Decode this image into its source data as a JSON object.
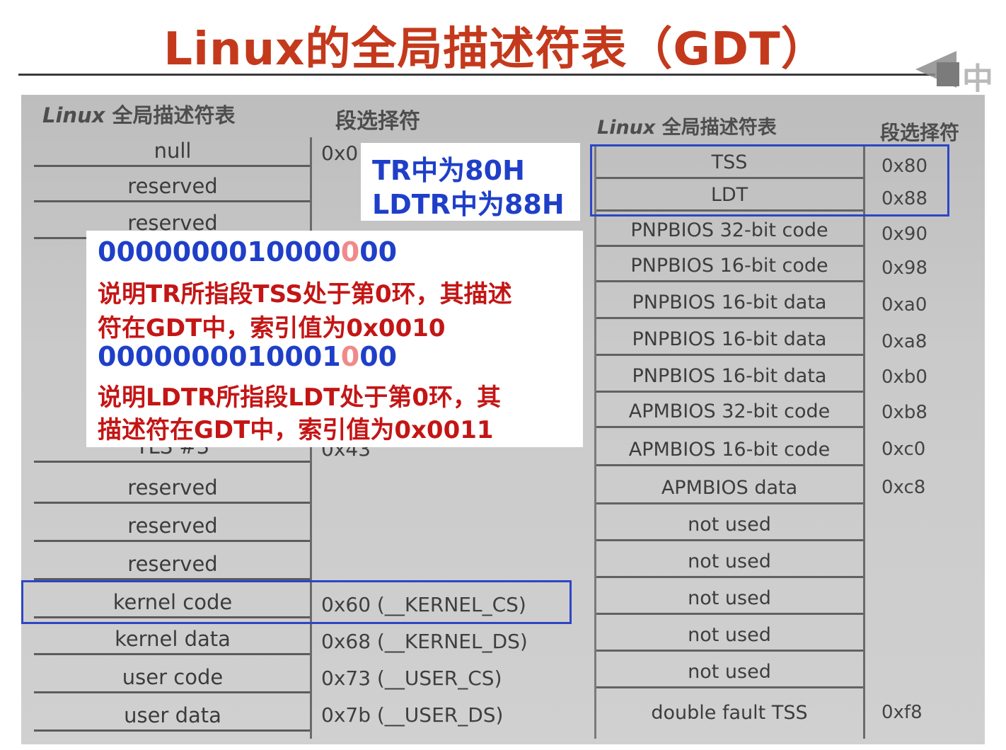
{
  "title": "Linux的全局描述符表（GDT）",
  "logo_text": "中国",
  "left_table": {
    "header_desc_italic": "Linux",
    "header_desc": "全局描述符表",
    "header_sel": "段选择符",
    "rows": [
      {
        "desc": "null",
        "sel": "0x0"
      },
      {
        "desc": "reserved",
        "sel": ""
      },
      {
        "desc": "reserved",
        "sel": ""
      },
      {
        "desc": "TLS #3",
        "sel": "0x43"
      },
      {
        "desc": "reserved",
        "sel": ""
      },
      {
        "desc": "reserved",
        "sel": ""
      },
      {
        "desc": "reserved",
        "sel": ""
      },
      {
        "desc": "kernel code",
        "sel": "0x60 (__KERNEL_CS)"
      },
      {
        "desc": "kernel data",
        "sel": "0x68 (__KERNEL_DS)"
      },
      {
        "desc": "user code",
        "sel": "0x73 (__USER_CS)"
      },
      {
        "desc": "user data",
        "sel": "0x7b (__USER_DS)"
      }
    ]
  },
  "right_table": {
    "header_desc_italic": "Linux",
    "header_desc": "全局描述符表",
    "header_sel": "段选择符",
    "rows": [
      {
        "desc": "TSS",
        "sel": "0x80"
      },
      {
        "desc": "LDT",
        "sel": "0x88"
      },
      {
        "desc": "PNPBIOS 32-bit code",
        "sel": "0x90"
      },
      {
        "desc": "PNPBIOS 16-bit code",
        "sel": "0x98"
      },
      {
        "desc": "PNPBIOS 16-bit data",
        "sel": "0xa0"
      },
      {
        "desc": "PNPBIOS 16-bit data",
        "sel": "0xa8"
      },
      {
        "desc": "PNPBIOS 16-bit data",
        "sel": "0xb0"
      },
      {
        "desc": "APMBIOS 32-bit code",
        "sel": "0xb8"
      },
      {
        "desc": "APMBIOS 16-bit code",
        "sel": "0xc0"
      },
      {
        "desc": "APMBIOS data",
        "sel": "0xc8"
      },
      {
        "desc": "not used",
        "sel": ""
      },
      {
        "desc": "not used",
        "sel": ""
      },
      {
        "desc": "not used",
        "sel": ""
      },
      {
        "desc": "not used",
        "sel": ""
      },
      {
        "desc": "not used",
        "sel": ""
      },
      {
        "desc": "double fault TSS",
        "sel": "0xf8"
      }
    ]
  },
  "callout_small": {
    "line1": "TR中为80H",
    "line2": "LDTR中为88H"
  },
  "callout_large": {
    "bin1_main": "0000000010000",
    "bin1_hl": "0",
    "bin1_tail": "00",
    "text1_a": "说明TR所指段TSS处于第0环，其描述",
    "text1_b": "符在GDT中，索引值为0x0010",
    "bin2_main": "0000000010001",
    "bin2_hl": "0",
    "bin2_tail": "00",
    "text2_a": "说明LDTR所指段LDT处于第0环，其",
    "text2_b": "描述符在GDT中，索引值为0x0011"
  },
  "colors": {
    "title": "#c4391c",
    "highlight_box": "#2d46c4",
    "callout_blue": "#1f3fc8",
    "callout_red": "#c41515",
    "callout_pink": "#f08a8a"
  }
}
